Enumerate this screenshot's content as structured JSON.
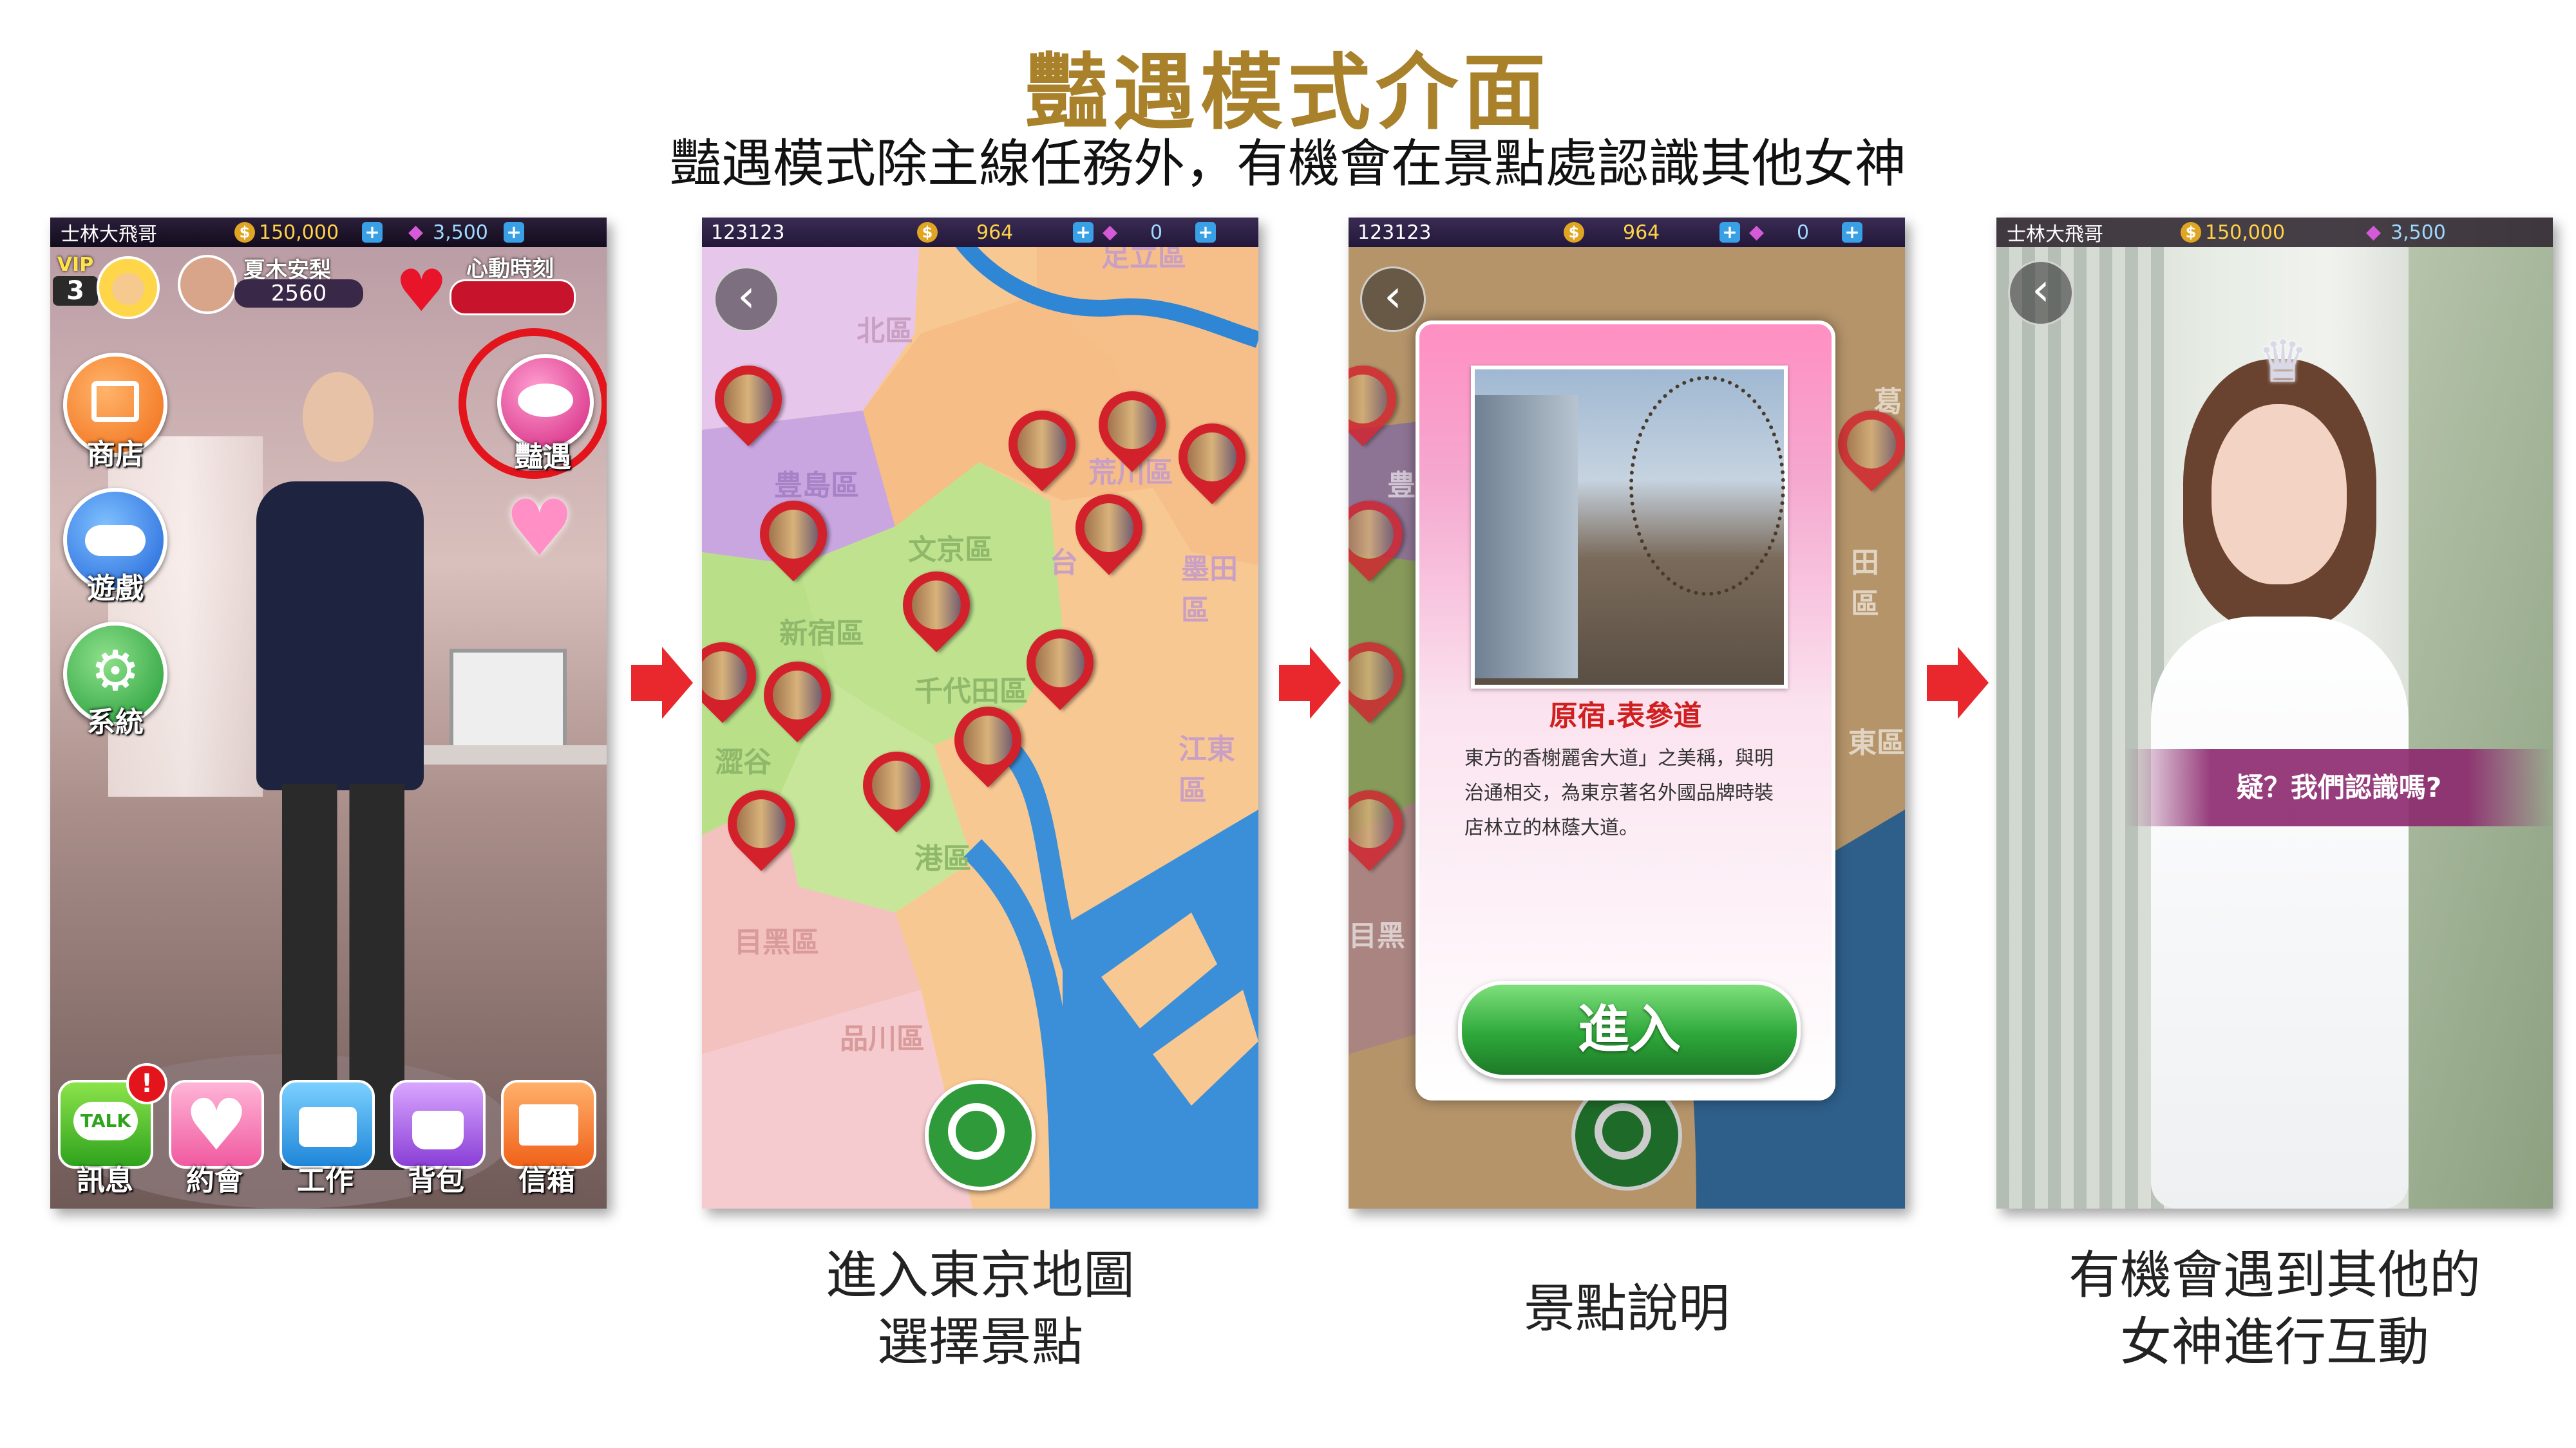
{
  "header": {
    "title": "豔遇模式介面",
    "subtitle": "豔遇模式除主線任務外，有機會在景點處認識其他女神"
  },
  "screen1": {
    "player_name": "士林大飛哥",
    "gold": "150,000",
    "diamonds": "3,500",
    "vip_label": "VIP",
    "vip_level": "3",
    "partner_name": "夏木安梨",
    "partner_score": "2560",
    "heart_label": "心動時刻",
    "left_buttons": [
      "商店",
      "遊戲",
      "系統"
    ],
    "encounter_label": "豔遇",
    "bottom_buttons": [
      "訊息",
      "約會",
      "工作",
      "背包",
      "信箱"
    ],
    "talk_icon_text": "TALK",
    "notification_badge": "!"
  },
  "screen2": {
    "user_id": "123123",
    "gold": "964",
    "diamonds": "0",
    "districts": [
      "北區",
      "豊島區",
      "文京區",
      "新宿區",
      "千代田區",
      "台",
      "墨田區",
      "江東區",
      "澀谷",
      "港區",
      "目黑區",
      "品川區",
      "足立區",
      "荒川區"
    ]
  },
  "screen3": {
    "user_id": "123123",
    "gold": "964",
    "diamonds": "0",
    "spot_name": "原宿.表參道",
    "spot_description": "東方的香榭麗舍大道」之美稱，與明治通相交，為東京著名外國品牌時裝店林立的林蔭大道。",
    "enter_button": "進入",
    "bg_districts": [
      "豊",
      "田區",
      "東區",
      "目黑",
      "葛"
    ]
  },
  "screen4": {
    "player_name": "士林大飛哥",
    "gold": "150,000",
    "diamonds": "3,500",
    "dialogue": "疑？我們認識嗎?"
  },
  "captions": {
    "step2": [
      "進入東京地圖",
      "選擇景點"
    ],
    "step3": "景點說明",
    "step4": [
      "有機會遇到其他的",
      "女神進行互動"
    ]
  },
  "colors": {
    "title": "#a9812b",
    "arrow": "#e8282d",
    "highlight_circle": "#e3141b",
    "pin": "#d3212c",
    "enter_button": "#2ea83a"
  }
}
